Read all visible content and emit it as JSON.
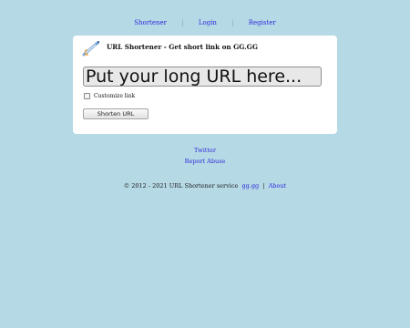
{
  "nav": {
    "items": [
      {
        "label": "Shortener"
      },
      {
        "label": "Login"
      },
      {
        "label": "Register"
      }
    ],
    "separator": "|"
  },
  "card": {
    "title": "URL Shortener - Get short link on GG.GG",
    "logo_icon": "rocket-icon",
    "url_input": {
      "value": "",
      "placeholder": "Put your long URL here..."
    },
    "customize_label": "Customize link",
    "customize_checked": false,
    "submit_label": "Shorten URL"
  },
  "links": {
    "twitter": "Twitter",
    "report": "Report Abuse"
  },
  "footer": {
    "copyright": "© 2012 - 2021 URL Shortener service",
    "domain_link": "gg.gg",
    "separator": "|",
    "about_link": "About"
  },
  "colors": {
    "background": "#b5d9e5",
    "link": "#2b2bd9",
    "card": "#ffffff"
  }
}
